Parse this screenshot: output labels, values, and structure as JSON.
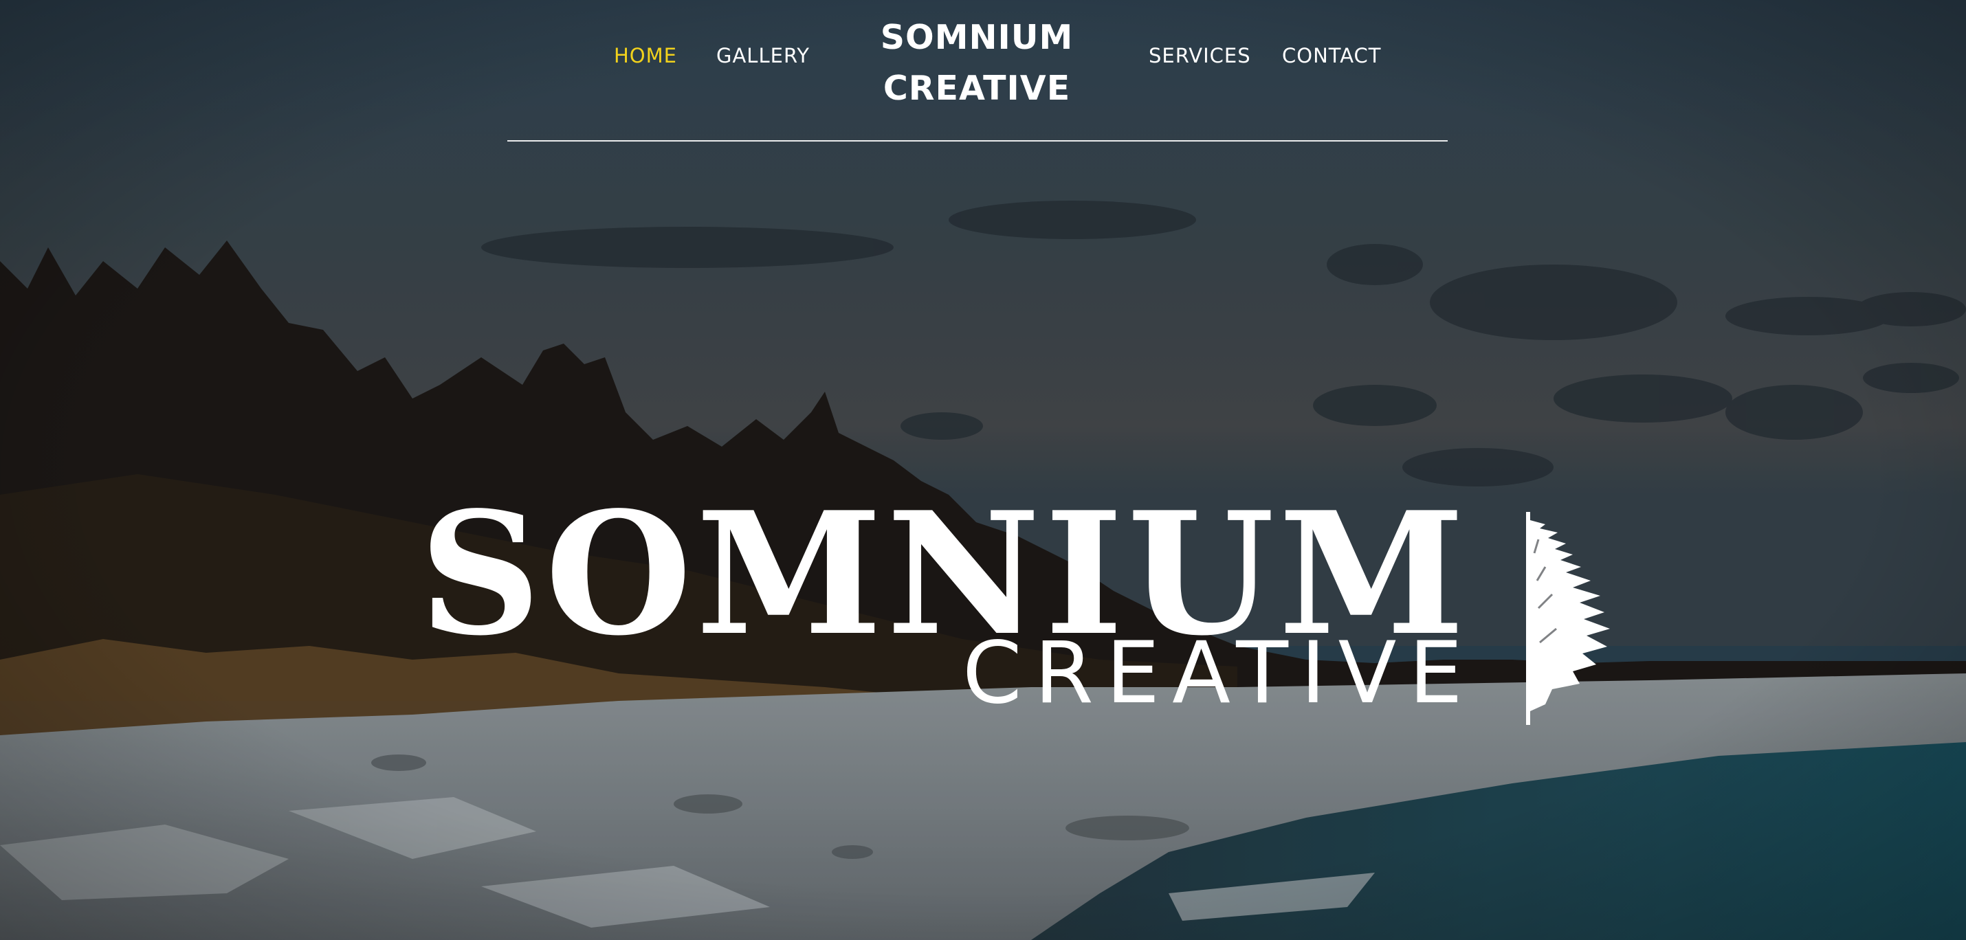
{
  "nav": {
    "home_label": "HOME",
    "gallery_label": "GALLERY",
    "services_label": "SERVICES",
    "contact_label": "CONTACT",
    "brand_line1": "SOMNIUM",
    "brand_line2": "CREATIVE"
  },
  "hero": {
    "logo_line1": "SOMNIUM",
    "logo_line2": "CREATIVE",
    "background": "snowy-lakeshore-photo"
  },
  "colors": {
    "active_nav": "#f2d21c",
    "text": "#ffffff",
    "divider": "#ffffff"
  }
}
